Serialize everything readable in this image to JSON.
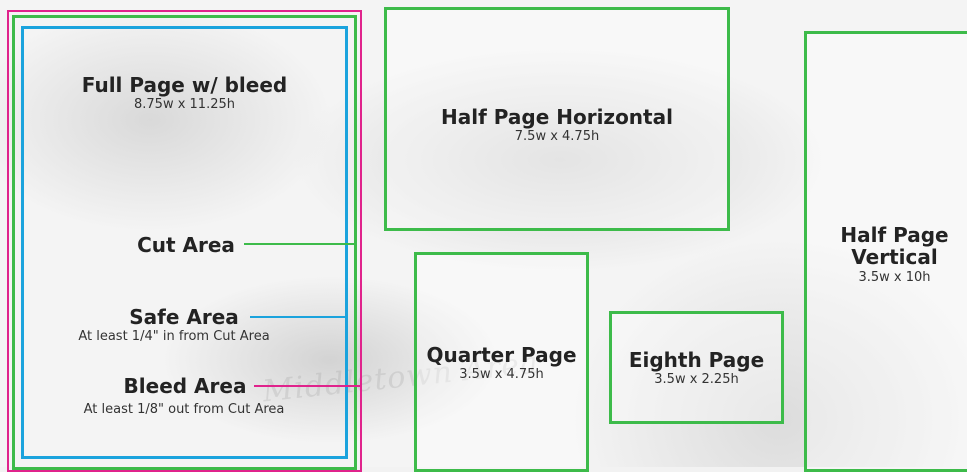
{
  "colors": {
    "cut": "#3dbb4a",
    "safe": "#1ba3dd",
    "bleed": "#e0238c"
  },
  "full_page": {
    "title": "Full Page w/ bleed",
    "size": "8.75w x 11.25h",
    "cut_label": "Cut Area",
    "safe_label": "Safe Area",
    "safe_note": "At least 1/4\" in from Cut Area",
    "bleed_label": "Bleed Area",
    "bleed_note": "At least 1/8\" out from Cut Area"
  },
  "half_horizontal": {
    "title": "Half Page Horizontal",
    "size": "7.5w x 4.75h"
  },
  "quarter": {
    "title": "Quarter Page",
    "size": "3.5w x 4.75h"
  },
  "eighth": {
    "title": "Eighth Page",
    "size": "3.5w x 2.25h"
  },
  "half_vertical": {
    "title_line1": "Half Page",
    "title_line2": "Vertical",
    "size": "3.5w x 10h"
  }
}
